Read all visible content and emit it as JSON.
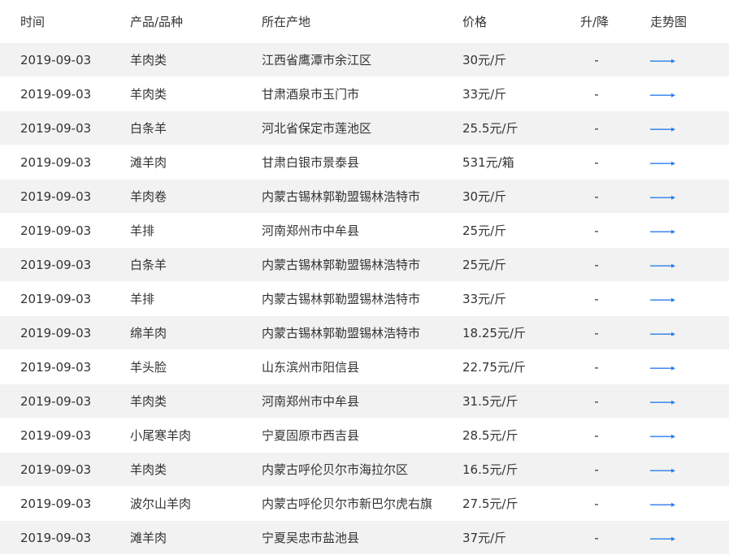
{
  "headers": {
    "date": "时间",
    "product": "产品/品种",
    "location": "所在产地",
    "price": "价格",
    "change": "升/降",
    "trend": "走势图"
  },
  "colors": {
    "trend_arrow": "#2b7de9",
    "row_alt": "#f2f2f2"
  },
  "rows": [
    {
      "date": "2019-09-03",
      "product": "羊肉类",
      "location": "江西省鹰潭市余江区",
      "price": "30元/斤",
      "change": "-"
    },
    {
      "date": "2019-09-03",
      "product": "羊肉类",
      "location": "甘肃酒泉市玉门市",
      "price": "33元/斤",
      "change": "-"
    },
    {
      "date": "2019-09-03",
      "product": "白条羊",
      "location": "河北省保定市莲池区",
      "price": "25.5元/斤",
      "change": "-"
    },
    {
      "date": "2019-09-03",
      "product": "滩羊肉",
      "location": "甘肃白银市景泰县",
      "price": "531元/箱",
      "change": "-"
    },
    {
      "date": "2019-09-03",
      "product": "羊肉卷",
      "location": "内蒙古锡林郭勒盟锡林浩特市",
      "price": "30元/斤",
      "change": "-"
    },
    {
      "date": "2019-09-03",
      "product": "羊排",
      "location": "河南郑州市中牟县",
      "price": "25元/斤",
      "change": "-"
    },
    {
      "date": "2019-09-03",
      "product": "白条羊",
      "location": "内蒙古锡林郭勒盟锡林浩特市",
      "price": "25元/斤",
      "change": "-"
    },
    {
      "date": "2019-09-03",
      "product": "羊排",
      "location": "内蒙古锡林郭勒盟锡林浩特市",
      "price": "33元/斤",
      "change": "-"
    },
    {
      "date": "2019-09-03",
      "product": "绵羊肉",
      "location": "内蒙古锡林郭勒盟锡林浩特市",
      "price": "18.25元/斤",
      "change": "-"
    },
    {
      "date": "2019-09-03",
      "product": "羊头脸",
      "location": "山东滨州市阳信县",
      "price": "22.75元/斤",
      "change": "-"
    },
    {
      "date": "2019-09-03",
      "product": "羊肉类",
      "location": "河南郑州市中牟县",
      "price": "31.5元/斤",
      "change": "-"
    },
    {
      "date": "2019-09-03",
      "product": "小尾寒羊肉",
      "location": "宁夏固原市西吉县",
      "price": "28.5元/斤",
      "change": "-"
    },
    {
      "date": "2019-09-03",
      "product": "羊肉类",
      "location": "内蒙古呼伦贝尔市海拉尔区",
      "price": "16.5元/斤",
      "change": "-"
    },
    {
      "date": "2019-09-03",
      "product": "波尔山羊肉",
      "location": "内蒙古呼伦贝尔市新巴尔虎右旗",
      "price": "27.5元/斤",
      "change": "-"
    },
    {
      "date": "2019-09-03",
      "product": "滩羊肉",
      "location": "宁夏吴忠市盐池县",
      "price": "37元/斤",
      "change": "-"
    }
  ]
}
